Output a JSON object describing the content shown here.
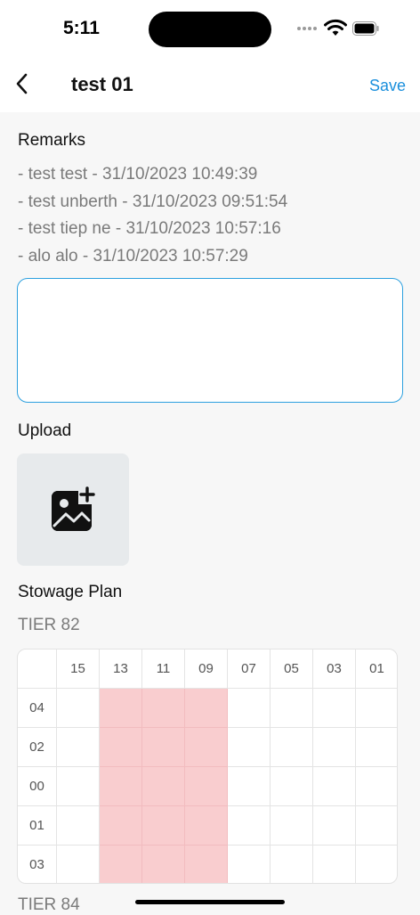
{
  "status_bar": {
    "time": "5:11"
  },
  "nav": {
    "title": "test 01",
    "save_label": "Save"
  },
  "remarks": {
    "label": "Remarks",
    "items": [
      "- test test - 31/10/2023 10:49:39",
      "- test unberth - 31/10/2023 09:51:54",
      "- test tiep ne - 31/10/2023 10:57:16",
      "- alo alo - 31/10/2023 10:57:29"
    ],
    "input_value": ""
  },
  "upload": {
    "label": "Upload",
    "icon": "add-image-icon"
  },
  "stowage": {
    "label": "Stowage Plan",
    "tiers": [
      {
        "name": "TIER 82",
        "bays": [
          "15",
          "13",
          "11",
          "09",
          "07",
          "05",
          "03",
          "01"
        ],
        "rows": [
          "04",
          "02",
          "00",
          "01",
          "03"
        ],
        "filled_bays": [
          "13",
          "11",
          "09"
        ],
        "filled_color": "#f9cdcf"
      },
      {
        "name": "TIER 84"
      }
    ]
  },
  "colors": {
    "accent": "#1a8fdc",
    "input_border": "#2ca0df"
  }
}
